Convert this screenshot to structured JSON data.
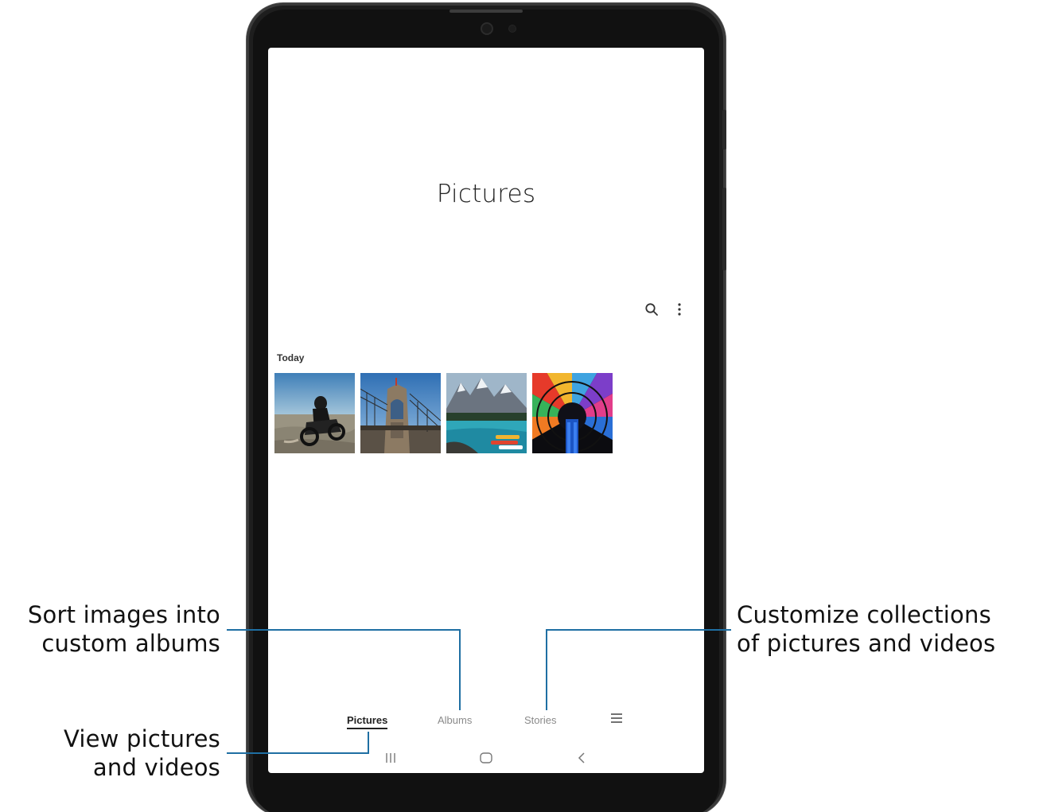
{
  "screen": {
    "title": "Pictures",
    "toolbar": {
      "search_icon": "search-icon",
      "more_icon": "more-options-icon"
    },
    "section_label": "Today",
    "thumbnails": [
      {
        "name": "motorcycle-photo"
      },
      {
        "name": "bridge-photo"
      },
      {
        "name": "mountain-lake-photo"
      },
      {
        "name": "stained-glass-photo"
      }
    ],
    "tabs": [
      {
        "label": "Pictures",
        "active": true
      },
      {
        "label": "Albums",
        "active": false
      },
      {
        "label": "Stories",
        "active": false
      }
    ],
    "tab_menu_icon": "hamburger-menu-icon",
    "nav_bar": {
      "recents_icon": "recent-apps-icon",
      "home_icon": "home-icon",
      "back_icon": "back-icon"
    }
  },
  "callouts": {
    "sort_line1": "Sort images into",
    "sort_line2": "custom albums",
    "view_line1": "View pictures",
    "view_line2": "and videos",
    "customize_line1": "Customize collections",
    "customize_line2": "of pictures and videos"
  },
  "colors": {
    "leader_line": "#1f6fa3",
    "device_body": "#1e1e1e",
    "screen_bg": "#ffffff",
    "active_tab": "#222222",
    "inactive_tab": "#8a8a8a"
  }
}
